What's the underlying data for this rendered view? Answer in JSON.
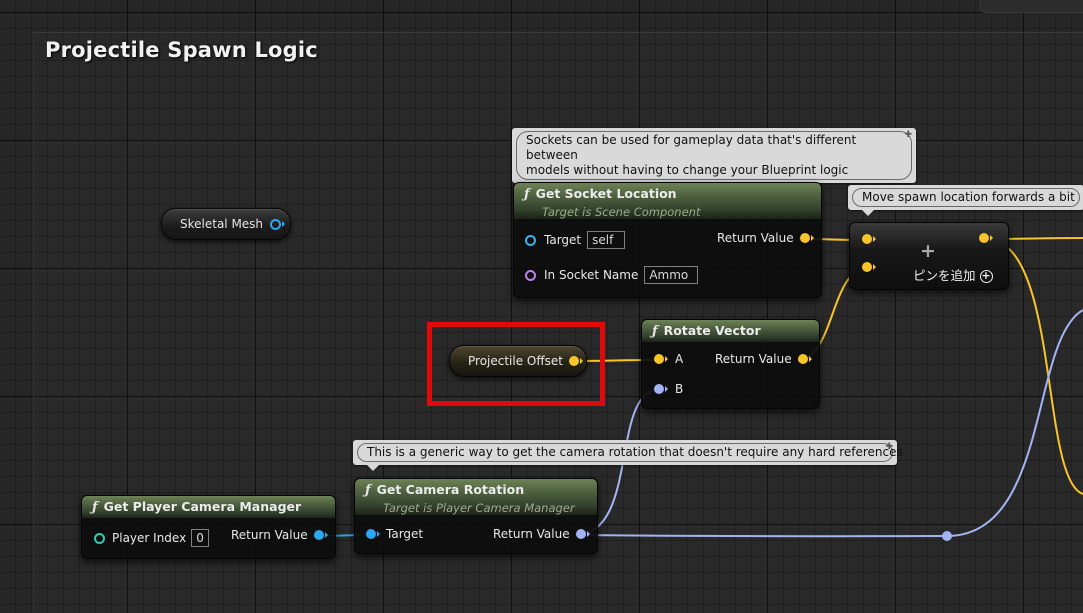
{
  "comment": {
    "title": "Projectile Spawn Logic"
  },
  "colors": {
    "vector_pin": "#f7c52a",
    "rotator_pin": "#a3b4f5",
    "object_pin": "#2aa8f0",
    "name_pin": "#c27ff0",
    "scene_pin": "#3ab0e8",
    "player_pin": "#38c7b0",
    "highlight": "#e00a0a"
  },
  "nodes": {
    "skeletal_mesh": {
      "label": "Skeletal Mesh"
    },
    "projectile_offset": {
      "label": "Projectile Offset"
    },
    "get_socket_location": {
      "icon": "function-icon",
      "title": "Get Socket Location",
      "subtitle": "Target is Scene Component",
      "pins": {
        "target_label": "Target",
        "target_default": "self",
        "socket_label": "In Socket Name",
        "socket_default": "Ammo",
        "return_label": "Return Value"
      }
    },
    "rotate_vector": {
      "icon": "function-icon",
      "title": "Rotate Vector",
      "pins": {
        "a_label": "A",
        "b_label": "B",
        "return_label": "Return Value"
      }
    },
    "add_vector": {
      "add_pin_label": "ピンを追加",
      "plus_glyph": "+"
    },
    "get_player_camera_manager": {
      "icon": "function-icon",
      "title": "Get Player Camera Manager",
      "pins": {
        "player_index_label": "Player Index",
        "player_index_value": "0",
        "return_label": "Return Value"
      }
    },
    "get_camera_rotation": {
      "icon": "function-icon",
      "title": "Get Camera Rotation",
      "subtitle": "Target is Player Camera Manager",
      "pins": {
        "target_label": "Target",
        "return_label": "Return Value"
      }
    }
  },
  "comment_bubbles": {
    "sockets": {
      "text": "Sockets can be used for gameplay data that's different between\nmodels without having to change your Blueprint logic"
    },
    "move_spawn": {
      "text": "Move spawn location forwards a bit"
    },
    "camera": {
      "text": "This is a generic way to get the camera rotation that doesn't require any hard references"
    }
  }
}
